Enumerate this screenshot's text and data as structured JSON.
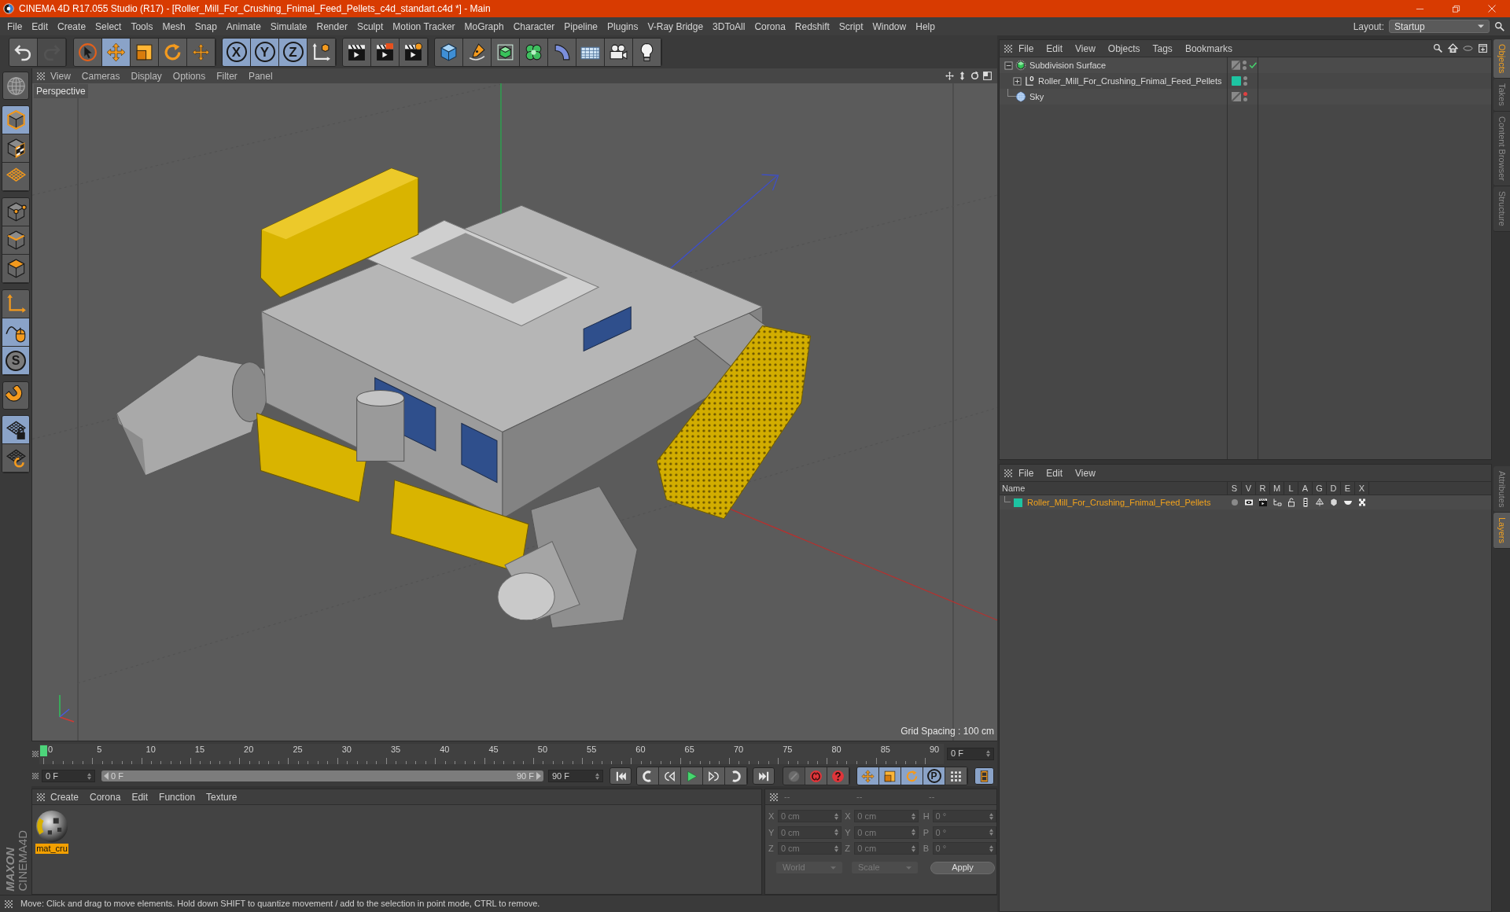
{
  "window": {
    "title": "CINEMA 4D R17.055 Studio (R17) - [Roller_Mill_For_Crushing_Fnimal_Feed_Pellets_c4d_standart.c4d *] - Main"
  },
  "menu_bar": {
    "items": [
      "File",
      "Edit",
      "Create",
      "Select",
      "Tools",
      "Mesh",
      "Snap",
      "Animate",
      "Simulate",
      "Render",
      "Sculpt",
      "Motion Tracker",
      "MoGraph",
      "Character",
      "Pipeline",
      "Plugins",
      "V-Ray Bridge",
      "3DToAll",
      "Corona",
      "Redshift",
      "Script",
      "Window",
      "Help"
    ],
    "layout": {
      "label": "Layout:",
      "value": "Startup"
    }
  },
  "toolbar": {
    "history": [
      {
        "kind": "undo",
        "disabled": false
      },
      {
        "kind": "redo",
        "disabled": true
      }
    ],
    "tools": [
      {
        "kind": "select",
        "active": false
      },
      {
        "kind": "move",
        "active": true
      },
      {
        "kind": "scale",
        "active": false
      },
      {
        "kind": "rotate",
        "active": false
      },
      {
        "kind": "transform",
        "active": false
      }
    ],
    "axes": [
      {
        "kind": "axis",
        "label": "X",
        "active": true
      },
      {
        "kind": "axis",
        "label": "Y",
        "active": true
      },
      {
        "kind": "axis",
        "label": "Z",
        "active": true
      },
      {
        "kind": "coordinates",
        "active": false
      }
    ],
    "render": [
      {
        "kind": "render-view"
      },
      {
        "kind": "render-picture"
      },
      {
        "kind": "render-settings"
      }
    ],
    "create": [
      {
        "kind": "cube"
      },
      {
        "kind": "pen"
      },
      {
        "kind": "subdivision"
      },
      {
        "kind": "cloner"
      },
      {
        "kind": "deformer"
      },
      {
        "kind": "floor"
      },
      {
        "kind": "camera"
      },
      {
        "kind": "light"
      }
    ]
  },
  "left_toolbar": [
    [
      {
        "kind": "globe",
        "active": false
      }
    ],
    [
      {
        "kind": "model",
        "active": true
      },
      {
        "kind": "texture",
        "active": false
      },
      {
        "kind": "workplane",
        "active": false
      }
    ],
    [
      {
        "kind": "points",
        "active": false
      },
      {
        "kind": "edges",
        "active": false
      },
      {
        "kind": "polygons",
        "active": false
      }
    ],
    [
      {
        "kind": "axis",
        "active": false
      },
      {
        "kind": "tweak",
        "active": true
      },
      {
        "kind": "soft-selection",
        "label": "S",
        "active": true
      }
    ],
    [
      {
        "kind": "snap",
        "active": false
      }
    ],
    [
      {
        "kind": "lock-workplane",
        "active": true
      },
      {
        "kind": "grid-rotate",
        "active": false
      }
    ]
  ],
  "viewport": {
    "menu": [
      "View",
      "Cameras",
      "Display",
      "Options",
      "Filter",
      "Panel"
    ],
    "camera": "Perspective",
    "grid_spacing": "Grid Spacing : 100 cm"
  },
  "timeline": {
    "ticks": [
      "0",
      "5",
      "10",
      "15",
      "20",
      "25",
      "30",
      "35",
      "40",
      "45",
      "50",
      "55",
      "60",
      "65",
      "70",
      "75",
      "80",
      "85",
      "90"
    ],
    "playhead": {
      "level": 0
    },
    "current_frame": "0 F"
  },
  "transport": {
    "start_field": "0 F",
    "range": {
      "start": "0 F",
      "end": "90 F",
      "level": 1
    },
    "end_field": "90 F",
    "go_start": {
      "kind": "go-start"
    },
    "playback": [
      {
        "kind": "prev-key"
      },
      {
        "kind": "step-back"
      },
      {
        "kind": "play"
      },
      {
        "kind": "step-forward"
      },
      {
        "kind": "next-key"
      }
    ],
    "go_end": {
      "kind": "go-end"
    },
    "keys": [
      {
        "kind": "record",
        "disabled": true
      },
      {
        "kind": "autokey",
        "disabled": false
      },
      {
        "kind": "keyframe-selection",
        "disabled": false
      }
    ],
    "key_filters": [
      {
        "kind": "position",
        "active": true
      },
      {
        "kind": "scale",
        "active": true
      },
      {
        "kind": "rotation",
        "active": true
      },
      {
        "kind": "parameter",
        "label": "P",
        "active": true
      },
      {
        "kind": "point-level",
        "active": false
      }
    ],
    "timeline_button": {
      "active": true
    }
  },
  "logo": {
    "brand": "MAXON",
    "product": "CINEMA4D"
  },
  "materials": {
    "menu": [
      "Create",
      "Corona",
      "Edit",
      "Function",
      "Texture"
    ],
    "items": [
      {
        "name": "mat_cru",
        "selected": true
      }
    ]
  },
  "coordinates": {
    "headers": [
      "--",
      "--",
      "--"
    ],
    "rows": [
      {
        "position_axis": "X",
        "position": "0 cm",
        "size_axis": "X",
        "size": "0 cm",
        "rotation_axis": "H",
        "rotation": "0 °"
      },
      {
        "position_axis": "Y",
        "position": "0 cm",
        "size_axis": "Y",
        "size": "0 cm",
        "rotation_axis": "P",
        "rotation": "0 °"
      },
      {
        "position_axis": "Z",
        "position": "0 cm",
        "size_axis": "Z",
        "size": "0 cm",
        "rotation_axis": "B",
        "rotation": "0 °"
      }
    ],
    "dropdowns": [
      "World",
      "Scale"
    ],
    "apply": "Apply"
  },
  "status_bar": "Move: Click and drag to move elements. Hold down SHIFT to quantize movement / add to the selection in point mode, CTRL to remove.",
  "object_manager": {
    "menu": [
      "File",
      "Edit",
      "View",
      "Objects",
      "Tags",
      "Bookmarks"
    ],
    "objects": [
      {
        "name": "Subdivision Surface",
        "kind": "subdivision",
        "expanded": true,
        "enabled": true,
        "editor_visible": true,
        "children": [
          {
            "name": "Roller_Mill_For_Crushing_Fnimal_Feed_Pellets",
            "kind": "null",
            "expanded": false,
            "enabled": false,
            "editor_visible": true,
            "color": "#1dc4a2"
          }
        ]
      },
      {
        "name": "Sky",
        "kind": "sky",
        "enabled": false,
        "editor_visible": false
      }
    ]
  },
  "layer_manager": {
    "menu": [
      "File",
      "Edit",
      "View"
    ],
    "columns": [
      "Name",
      "S",
      "V",
      "R",
      "M",
      "L",
      "A",
      "G",
      "D",
      "E",
      "X"
    ],
    "layers": [
      {
        "name": "Roller_Mill_For_Crushing_Fnimal_Feed_Pellets",
        "color": "#1dc4a2",
        "selected": true
      }
    ]
  },
  "side_tabs": {
    "top": [
      {
        "label": "Objects",
        "selected": true
      },
      {
        "label": "Takes",
        "selected": false
      },
      {
        "label": "Content Browser",
        "selected": false
      },
      {
        "label": "Structure",
        "selected": false
      }
    ],
    "bottom": [
      {
        "label": "Attributes",
        "selected": false
      },
      {
        "label": "Layers",
        "selected": true
      }
    ]
  }
}
